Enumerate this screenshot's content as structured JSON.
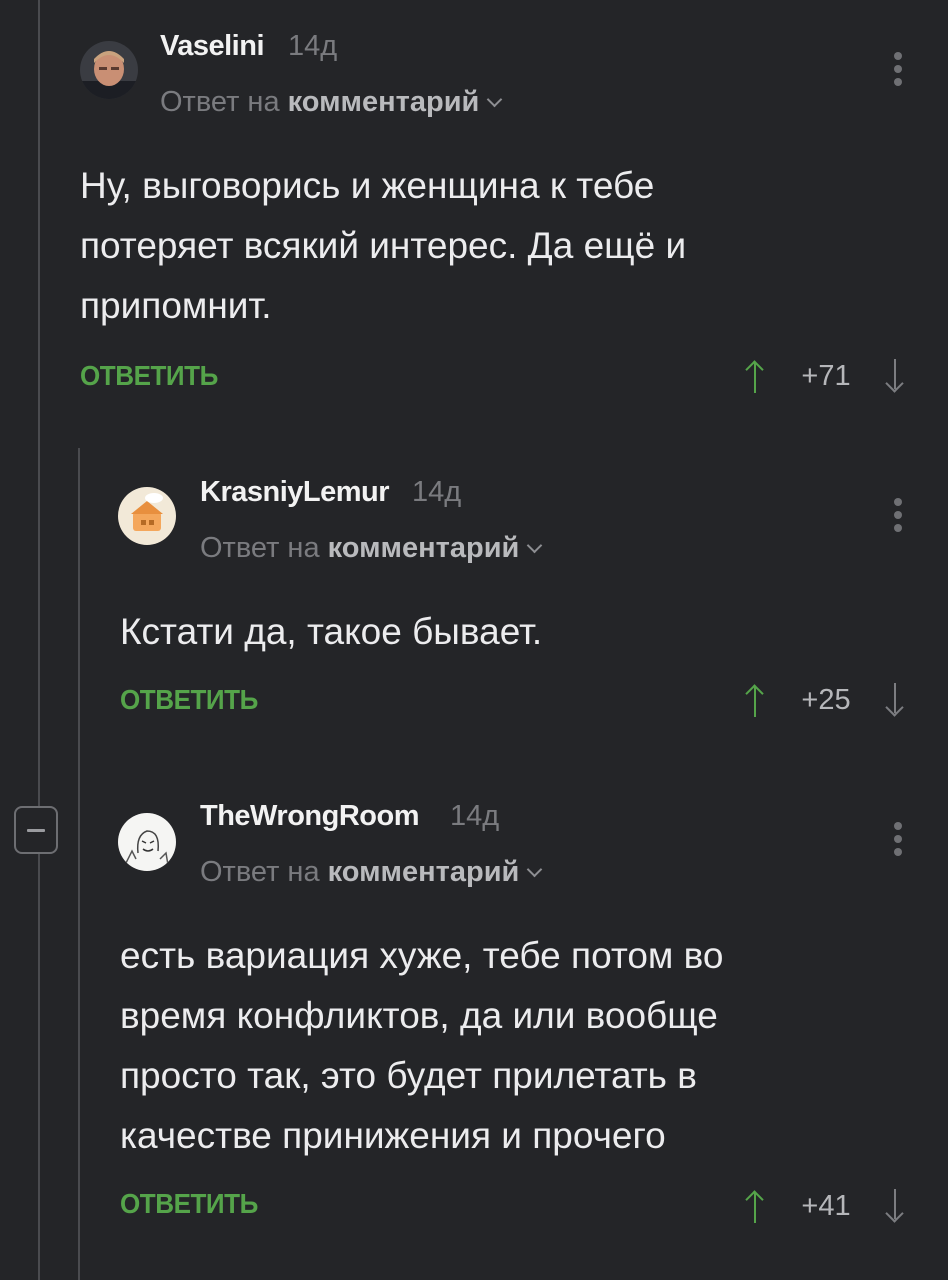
{
  "comments": [
    {
      "author": "Vaselini",
      "time": "14д",
      "reply_prefix": "Ответ на",
      "reply_link": "комментарий",
      "text": "Ну, выговорись и женщина к тебе\nпотеряет всякий интерес. Да ещё и\nприпомнит.",
      "reply_label": "ОТВЕТИТЬ",
      "score": "+71"
    },
    {
      "author": "KrasniyLemur",
      "time": "14д",
      "reply_prefix": "Ответ на",
      "reply_link": "комментарий",
      "text": "Кстати да, такое бывает.",
      "reply_label": "ОТВЕТИТЬ",
      "score": "+25"
    },
    {
      "author": "TheWrongRoom",
      "time": "14д",
      "reply_prefix": "Ответ на",
      "reply_link": "комментарий",
      "text": "есть вариация хуже, тебе потом во\nвремя конфликтов, да или вообще\nпросто так, это будет прилетать в\nкачестве принижения и прочего",
      "reply_label": "ОТВЕТИТЬ",
      "score": "+41"
    }
  ],
  "icons": {
    "more": "kebab-vertical-icon",
    "upvote": "arrow-up-icon",
    "downvote": "arrow-down-icon",
    "collapse": "minus-icon"
  },
  "colors": {
    "background": "#242528",
    "accent_green": "#55a44a",
    "muted_text": "#7a7b7f"
  }
}
